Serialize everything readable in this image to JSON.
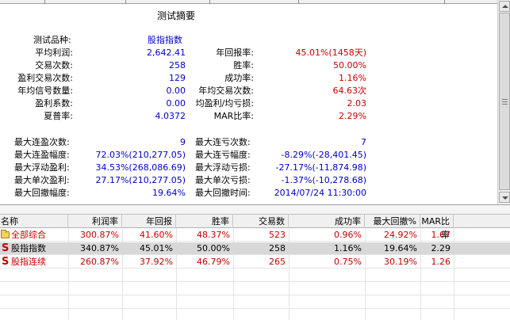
{
  "summary": {
    "title": "测试摘要",
    "product_label": "测试品种:",
    "product_value": "股指指数",
    "left": [
      {
        "label": "平均利润:",
        "value": "2,642.41"
      },
      {
        "label": "交易次数:",
        "value": "258"
      },
      {
        "label": "盈利交易次数:",
        "value": "129"
      },
      {
        "label": "年均信号数量:",
        "value": "0.00"
      },
      {
        "label": "盈利系数:",
        "value": "0.00"
      },
      {
        "label": "夏普率:",
        "value": "4.0372"
      }
    ],
    "right": [
      {
        "label": "年回报率:",
        "value": "45.01%(1458天)"
      },
      {
        "label": "胜率:",
        "value": "50.00%"
      },
      {
        "label": "成功率:",
        "value": "1.16%"
      },
      {
        "label": "年均交易次数:",
        "value": "64.63次"
      },
      {
        "label": "均盈利/均亏损:",
        "value": "2.03"
      },
      {
        "label": "MAR比率:",
        "value": "2.29%"
      }
    ],
    "left2": [
      {
        "label": "最大连盈次数:",
        "value": "9"
      },
      {
        "label": "最大连盈幅度:",
        "value": "72.03%(210,277.05)"
      },
      {
        "label": "最大浮动盈利:",
        "value": "34.53%(268,086.69)"
      },
      {
        "label": "最大单次盈利:",
        "value": "27.17%(210,277.05)"
      },
      {
        "label": "最大回撤幅度:",
        "value": "19.64%"
      }
    ],
    "right2": [
      {
        "label": "最大连亏次数:",
        "value": "7"
      },
      {
        "label": "最大连亏幅度:",
        "value": "-8.29%(-28,401.45)"
      },
      {
        "label": "最大浮动亏损:",
        "value": "-27.17%(-11,874.98)"
      },
      {
        "label": "最大单次亏损:",
        "value": "-1.37%(-10,278.68)"
      },
      {
        "label": "最大回撤时间:",
        "value": "2014/07/24 11:30:00"
      }
    ]
  },
  "grid": {
    "headers": [
      "名称",
      "利润率",
      "年回报",
      "胜率",
      "交易数",
      "成功率",
      "最大回撤%",
      "MAR比率"
    ],
    "rows": [
      {
        "icon": "folder-icon",
        "name": "全部综合",
        "cells": [
          "300.87%",
          "41.60%",
          "48.37%",
          "523",
          "0.96%",
          "24.92%",
          "1.67"
        ]
      },
      {
        "icon": "s-icon",
        "name": "股指指数",
        "cells": [
          "340.87%",
          "45.01%",
          "50.00%",
          "258",
          "1.16%",
          "19.64%",
          "2.29"
        ]
      },
      {
        "icon": "s-icon",
        "name": "股指连续",
        "cells": [
          "260.87%",
          "37.92%",
          "46.79%",
          "265",
          "0.75%",
          "30.19%",
          "1.26"
        ]
      }
    ],
    "s_glyph": "S"
  },
  "colors": {
    "blue": "#0000c8",
    "red": "#c80000",
    "selected_row": "#d8d8d8"
  }
}
